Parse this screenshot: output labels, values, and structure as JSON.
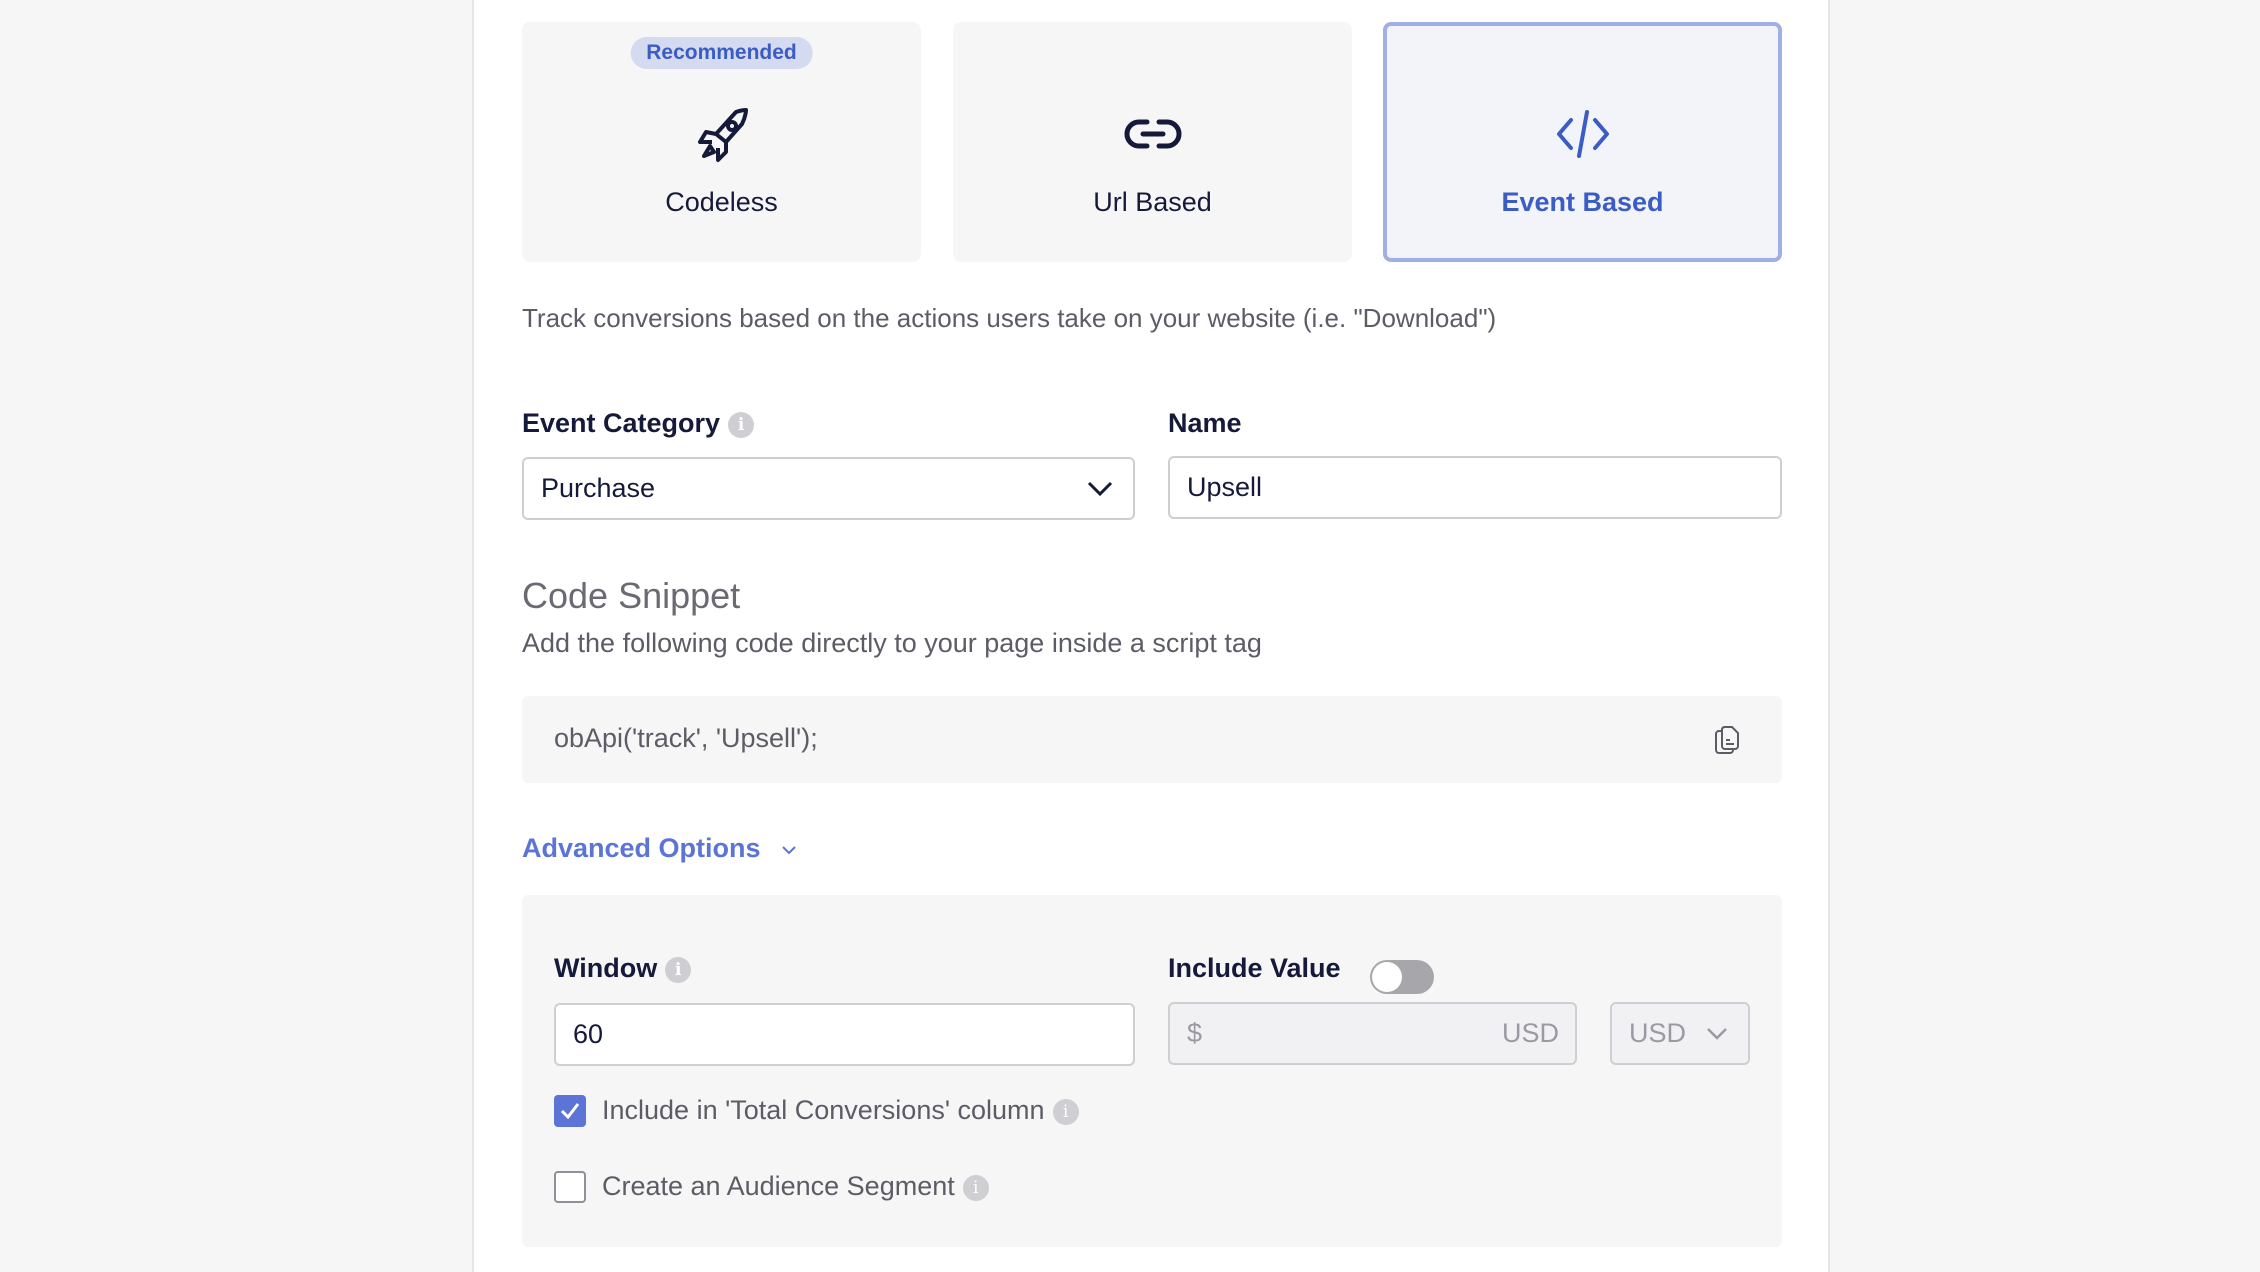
{
  "tracking_types": [
    {
      "label": "Codeless",
      "icon": "rocket-icon",
      "badge": "Recommended",
      "selected": false
    },
    {
      "label": "Url Based",
      "icon": "link-icon",
      "selected": false
    },
    {
      "label": "Event Based",
      "icon": "code-icon",
      "selected": true
    }
  ],
  "description": "Track conversions based on the actions users take on your website (i.e. \"Download\")",
  "event_category": {
    "label": "Event Category",
    "info": "i",
    "value": "Purchase"
  },
  "name": {
    "label": "Name",
    "value": "Upsell"
  },
  "code_snippet": {
    "title": "Code Snippet",
    "subtitle": "Add the following code directly to your page inside a script tag",
    "code": "obApi('track', 'Upsell');"
  },
  "advanced": {
    "toggle_label": "Advanced Options",
    "window": {
      "label": "Window",
      "info": "i",
      "value": "60"
    },
    "include_value": {
      "label": "Include Value",
      "enabled": false,
      "prefix": "$",
      "suffix": "USD",
      "currency": "USD"
    },
    "checkboxes": [
      {
        "label": "Include in 'Total Conversions' column",
        "checked": true,
        "info": "i"
      },
      {
        "label": "Create an Audience Segment",
        "checked": false,
        "info": "i"
      }
    ]
  },
  "colors": {
    "accent": "#3a5cc4",
    "link": "#5b74d6",
    "selected_border": "#a1b0e4",
    "badge_bg": "#d4daf0"
  }
}
